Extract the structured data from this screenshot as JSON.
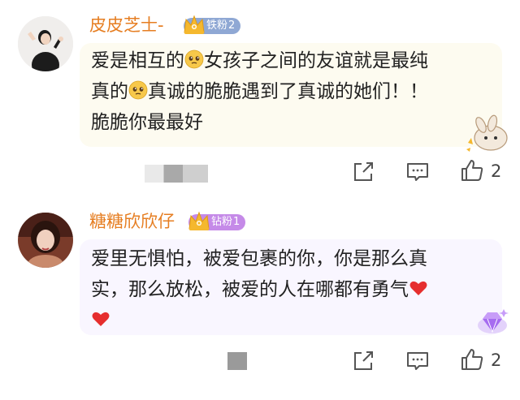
{
  "comments": [
    {
      "username": "皮皮芝士-",
      "badge": {
        "label": "铁粉",
        "level": "2",
        "color": "#8fa8d4"
      },
      "text_lines": [
        [
          "爱是相互的",
          "{emoji}",
          "女孩子之间的友谊就是最纯"
        ],
        [
          "真的",
          "{emoji}",
          "真诚的脆脆遇到了真诚的她们！！"
        ],
        [
          "脆脆你最最好"
        ]
      ],
      "emoji_icon": "pleading-face-icon",
      "like_count": "2",
      "bubble_color": "#fdfbf0"
    },
    {
      "username": "糖糖欣欣仔",
      "badge": {
        "label": "钻粉",
        "level": "1",
        "color": "#c58ae8"
      },
      "text_lines": [
        [
          "爱里无惧怕，被爱包裹的你，你是那么真"
        ],
        [
          "实，那么放松，被爱的人在哪都有勇气",
          "{heart}"
        ],
        [
          "{heart}"
        ]
      ],
      "emoji_icon": "red-heart-icon",
      "like_count": "2",
      "bubble_color": "#f9f6ff"
    }
  ],
  "colors": {
    "username": "#e67e22",
    "accent_heart": "#e62e2e"
  }
}
